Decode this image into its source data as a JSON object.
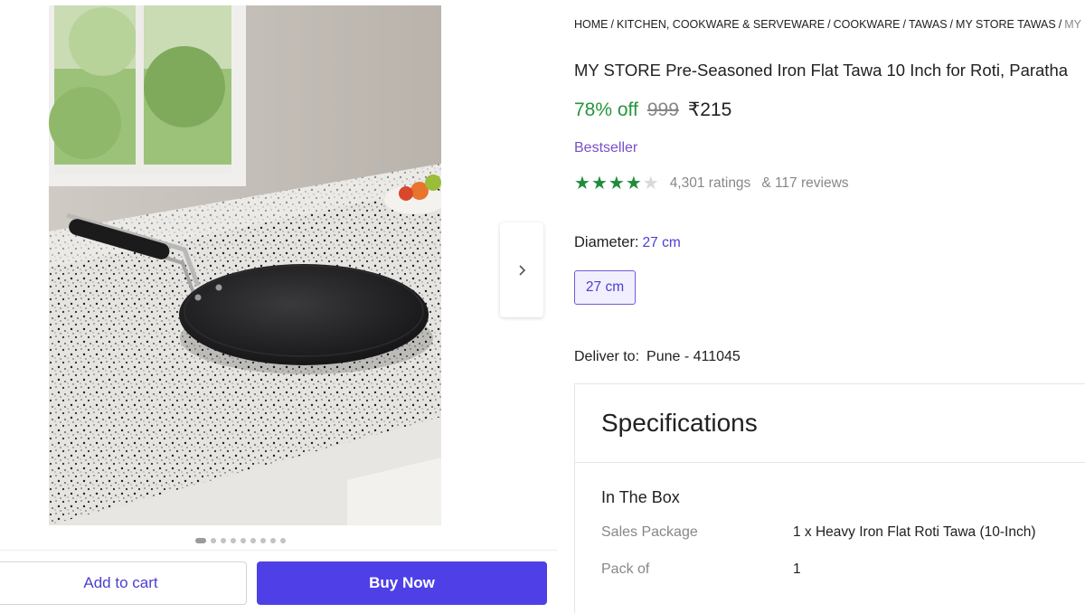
{
  "gallery": {
    "product_image_icon": "tawa-product-photo",
    "next_icon": "chevron-right-icon",
    "dots_total": 9,
    "dots_active_index": 0
  },
  "actions": {
    "add_to_cart": "Add to cart",
    "buy_now": "Buy Now"
  },
  "breadcrumb": {
    "items": [
      "HOME",
      "KITCHEN, COOKWARE & SERVEWARE",
      "COOKWARE",
      "TAWAS",
      "MY STORE TAWAS",
      "MY STOR"
    ],
    "separator": "/"
  },
  "product": {
    "title": "MY STORE Pre-Seasoned Iron Flat Tawa 10 Inch for Roti, Paratha",
    "discount": "78% off",
    "mrp": "999",
    "price": "₹215",
    "bestseller": "Bestseller",
    "rating_stars": 4,
    "ratings_text": "4,301 ratings",
    "reviews_text": "& 117 reviews"
  },
  "variant": {
    "label": "Diameter:",
    "selected": "27 cm",
    "options": [
      "27 cm"
    ]
  },
  "delivery": {
    "label": "Deliver to:",
    "location": "Pune - 411045"
  },
  "specifications": {
    "title": "Specifications",
    "group": "In The Box",
    "rows": [
      {
        "key": "Sales Package",
        "value": "1 x Heavy Iron Flat Roti Tawa (10-Inch)"
      },
      {
        "key": "Pack of",
        "value": "1"
      }
    ]
  },
  "colors": {
    "accent": "#4e40e6",
    "discount_green": "#26953d",
    "bestseller_purple": "#7a4fc6",
    "star_green": "#1f8c3a"
  }
}
